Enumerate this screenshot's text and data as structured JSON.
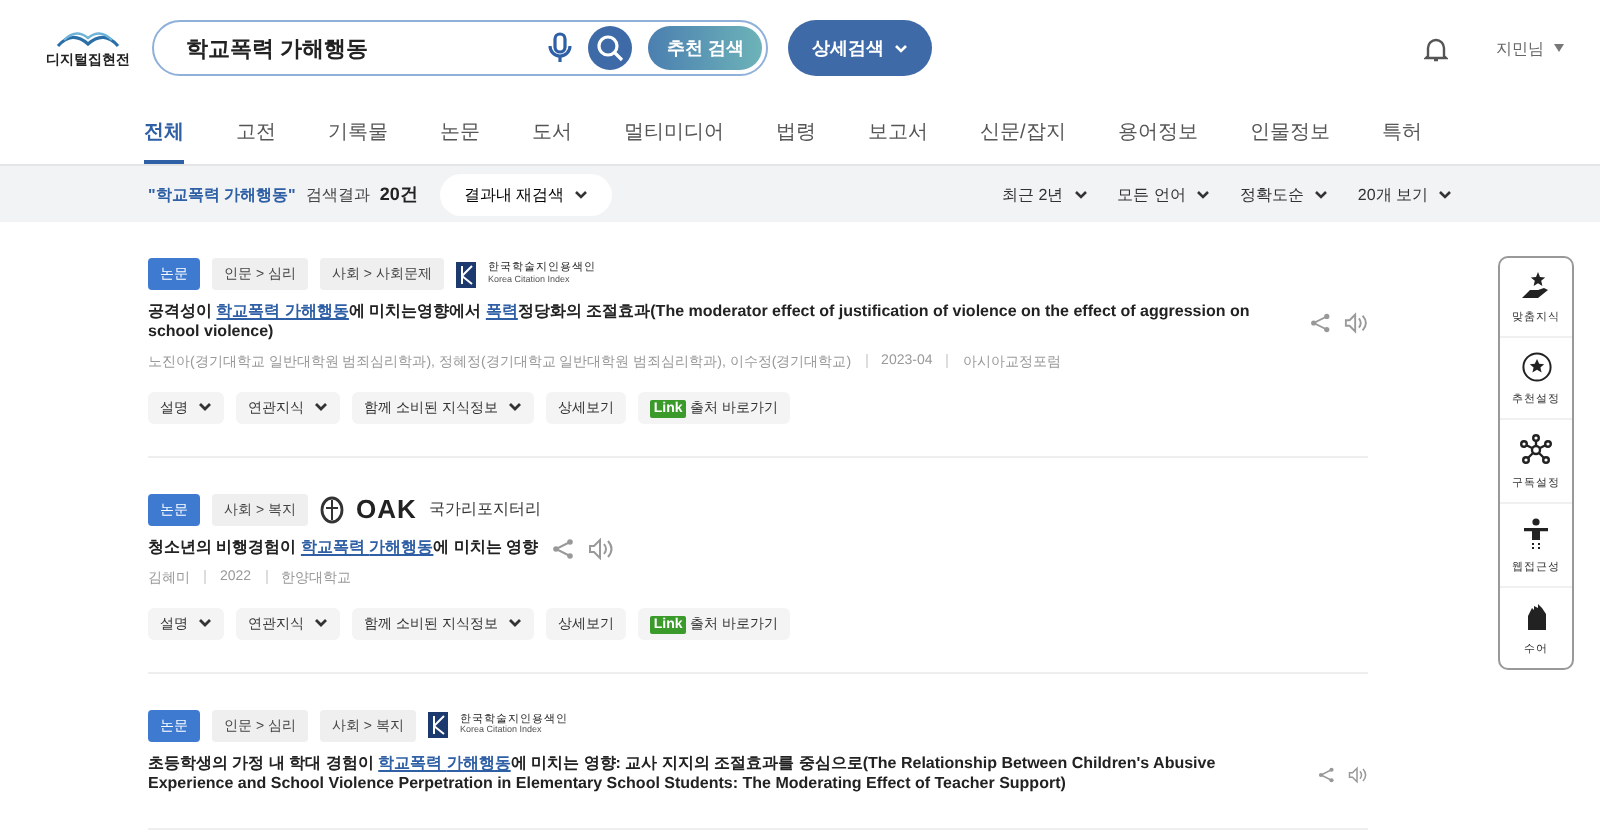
{
  "header": {
    "logo_text": "디지털집현전",
    "search_value": "학교폭력 가해행동",
    "recommend_button": "추천 검색",
    "advanced_button": "상세검색",
    "user": "지민님"
  },
  "tabs": [
    {
      "label": "전체",
      "selected": true
    },
    {
      "label": "고전",
      "selected": false
    },
    {
      "label": "기록물",
      "selected": false
    },
    {
      "label": "논문",
      "selected": false
    },
    {
      "label": "도서",
      "selected": false
    },
    {
      "label": "멀티미디어",
      "selected": false
    },
    {
      "label": "법령",
      "selected": false
    },
    {
      "label": "보고서",
      "selected": false
    },
    {
      "label": "신문/잡지",
      "selected": false
    },
    {
      "label": "용어정보",
      "selected": false
    },
    {
      "label": "인물정보",
      "selected": false
    },
    {
      "label": "특허",
      "selected": false
    }
  ],
  "filter_bar": {
    "query": "\"학교폭력 가해행동\"",
    "result_label": "검색결과",
    "result_count": "20건",
    "refine_button": "결과내 재검색",
    "dropdowns": [
      "최근 2년",
      "모든 언어",
      "정확도순",
      "20개 보기"
    ]
  },
  "results": [
    {
      "type": "논문",
      "categories": [
        "인문 > 심리",
        "사회 > 사회문제"
      ],
      "source": {
        "kind": "kci",
        "name": "한국학술지인용색인",
        "subtitle": "Korea Citation Index"
      },
      "title": [
        {
          "text": "공격성이 ",
          "highlight": false
        },
        {
          "text": "학교폭력 ",
          "highlight": true
        },
        {
          "text": "가해행동",
          "highlight": true
        },
        {
          "text": "에 미치는영향에서 ",
          "highlight": false
        },
        {
          "text": "폭력",
          "highlight": true
        },
        {
          "text": "정당화의 조절효과(The moderator effect of justification of violence on the effect of aggression on school violence)",
          "highlight": false
        }
      ],
      "meta": [
        "노진아(경기대학교 일반대학원 범죄심리학과), 정혜정(경기대학교 일반대학원 범죄심리학과), 이수정(경기대학교)",
        "2023-04",
        "아시아교정포럼"
      ],
      "actions": [
        {
          "label": "설명",
          "dropdown": true
        },
        {
          "label": "연관지식",
          "dropdown": true
        },
        {
          "label": "함께 소비된 지식정보",
          "dropdown": true
        },
        {
          "label": "상세보기",
          "dropdown": false
        }
      ],
      "link_badge": "Link",
      "link_label": "출처 바로가기"
    },
    {
      "type": "논문",
      "categories": [
        "사회 > 복지"
      ],
      "source": {
        "kind": "oak",
        "name": "OAK",
        "subtitle": "국가리포지터리"
      },
      "title": [
        {
          "text": "청소년의 비행경험이 ",
          "highlight": false
        },
        {
          "text": "학교폭력 ",
          "highlight": true
        },
        {
          "text": "가해행동",
          "highlight": true
        },
        {
          "text": "에 미치는 영향",
          "highlight": false
        }
      ],
      "meta": [
        "김혜미",
        "2022",
        "한양대학교"
      ],
      "actions": [
        {
          "label": "설명",
          "dropdown": true
        },
        {
          "label": "연관지식",
          "dropdown": true
        },
        {
          "label": "함께 소비된 지식정보",
          "dropdown": true
        },
        {
          "label": "상세보기",
          "dropdown": false
        }
      ],
      "link_badge": "Link",
      "link_label": "출처 바로가기"
    },
    {
      "type": "논문",
      "categories": [
        "인문 > 심리",
        "사회 > 복지"
      ],
      "source": {
        "kind": "kci",
        "name": "한국학술지인용색인",
        "subtitle": "Korea Citation Index"
      },
      "title": [
        {
          "text": "초등학생의 가정 내 학대 경험이 ",
          "highlight": false
        },
        {
          "text": "학교폭력 ",
          "highlight": true
        },
        {
          "text": "가해행동",
          "highlight": true
        },
        {
          "text": "에 미치는 영향: 교사 지지의 조절효과를 중심으로(The Relationship Between Children's Abusive Experience and School Violence Perpetration in Elementary School Students: The Moderating Effect of Teacher Support)",
          "highlight": false
        }
      ]
    }
  ],
  "side_menu": [
    {
      "kind": "hand",
      "label": "맞춤지식"
    },
    {
      "kind": "star",
      "label": "추천설정"
    },
    {
      "kind": "network",
      "label": "구독설정"
    },
    {
      "kind": "person",
      "label": "웹접근성"
    },
    {
      "kind": "sign",
      "label": "수어"
    }
  ]
}
